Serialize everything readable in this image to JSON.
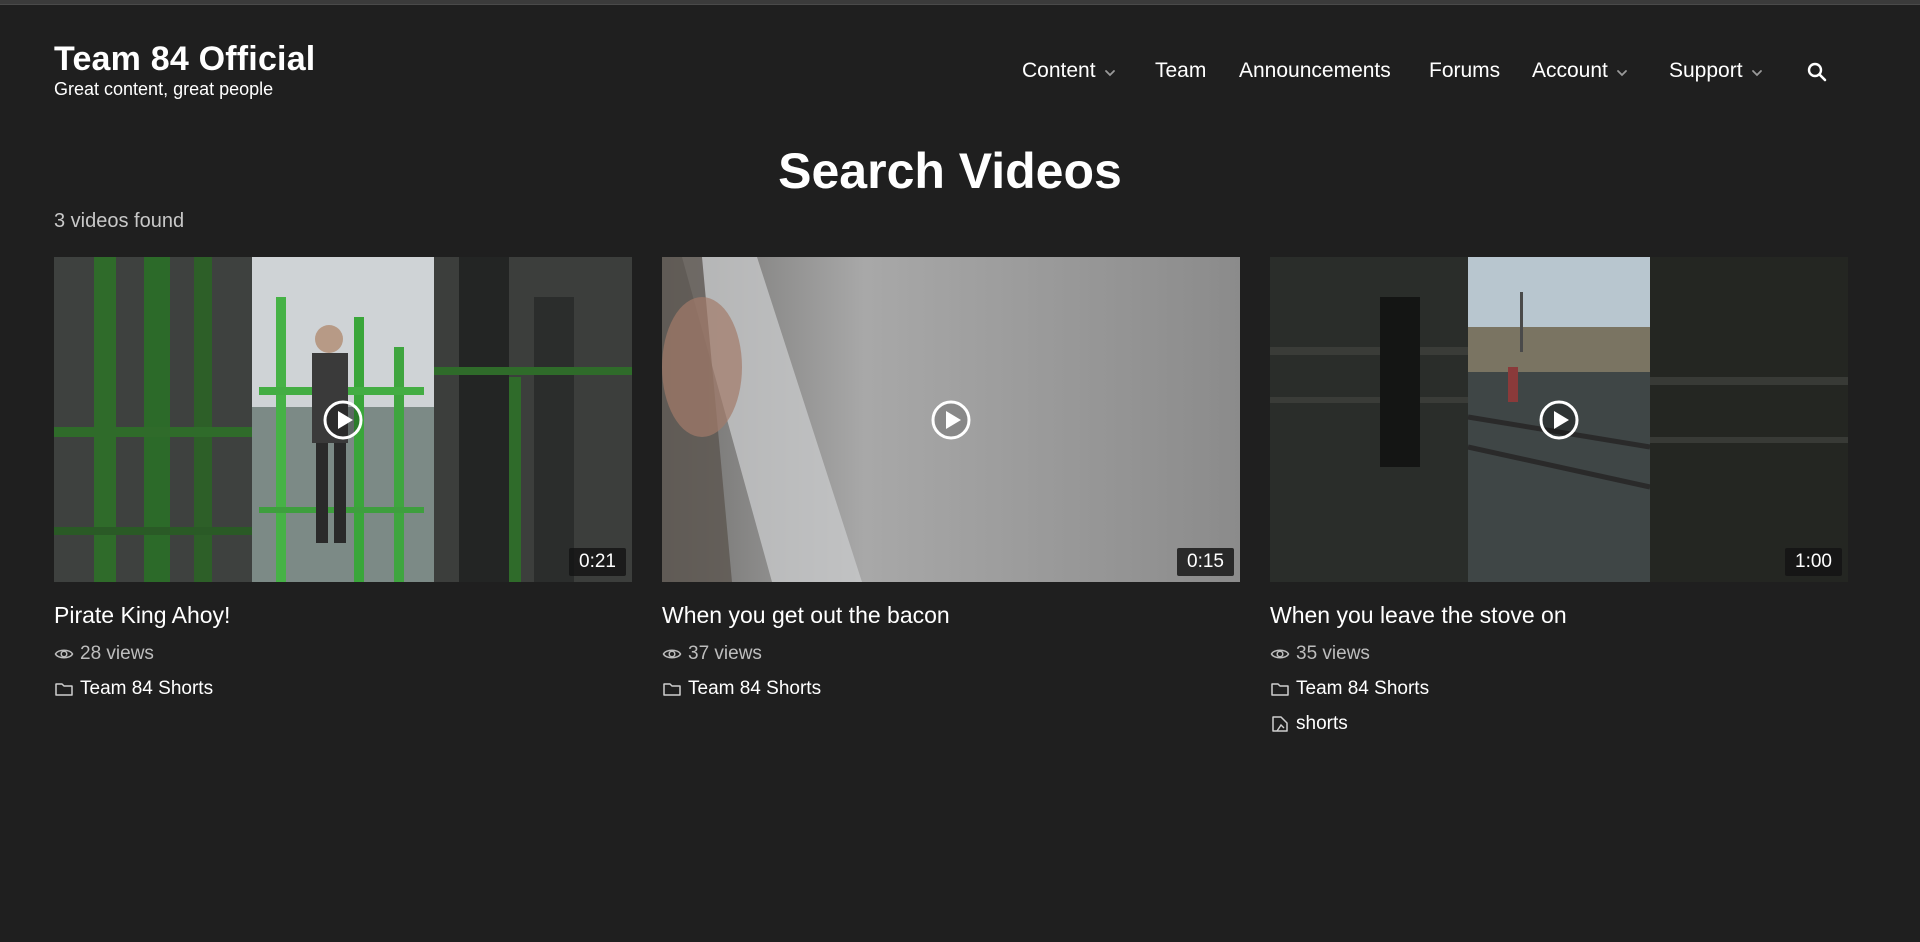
{
  "site": {
    "title": "Team 84 Official",
    "tagline": "Great content, great people"
  },
  "nav": {
    "items": [
      {
        "label": "Content",
        "has_dropdown": true
      },
      {
        "label": "Team",
        "has_dropdown": false
      },
      {
        "label": "Announcements",
        "has_dropdown": false
      },
      {
        "label": "Forums",
        "has_dropdown": false
      },
      {
        "label": "Account",
        "has_dropdown": true
      },
      {
        "label": "Support",
        "has_dropdown": true
      }
    ],
    "search_icon": "search-icon"
  },
  "page": {
    "title": "Search Videos",
    "result_count": "3 videos found"
  },
  "videos": [
    {
      "title": "Pirate King Ahoy!",
      "duration": "0:21",
      "views": "28 views",
      "category": "Team 84 Shorts",
      "tag": ""
    },
    {
      "title": "When you get out the bacon",
      "duration": "0:15",
      "views": "37 views",
      "category": "Team 84 Shorts",
      "tag": ""
    },
    {
      "title": "When you leave the stove on",
      "duration": "1:00",
      "views": "35 views",
      "category": "Team 84 Shorts",
      "tag": "shorts"
    }
  ],
  "colors": {
    "background": "#1f1f1f",
    "text": "#ffffff",
    "muted_text": "#bdbdbd"
  }
}
